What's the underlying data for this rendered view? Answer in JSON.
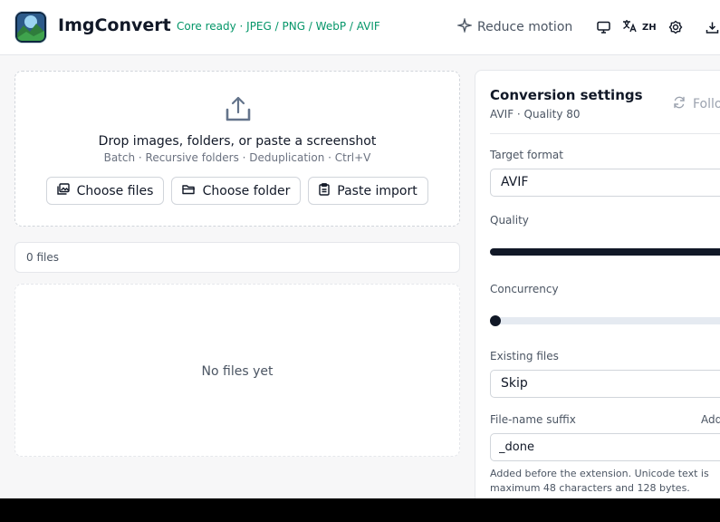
{
  "header": {
    "app_name": "ImgConvert",
    "core_status": "Core ready · JPEG / PNG / WebP / AVIF",
    "reduce_motion_label": "Reduce motion",
    "lang_label": "ZH",
    "icons": [
      "logo-icon",
      "sparkle-icon",
      "monitor-icon",
      "translate-icon",
      "theme-icon",
      "download-icon"
    ]
  },
  "dropzone": {
    "title": "Drop images, folders, or paste a screenshot",
    "subtitle": "Batch · Recursive folders · Deduplication · Ctrl+V",
    "buttons": {
      "choose_files": "Choose files",
      "choose_folder": "Choose folder",
      "paste_import": "Paste import"
    }
  },
  "files": {
    "count_label": "0 files",
    "empty_text": "No files yet"
  },
  "settings": {
    "title": "Conversion settings",
    "subtitle": "AVIF · Quality 80",
    "follow_label": "Follo",
    "target_format_label": "Target format",
    "target_format_value": "AVIF",
    "quality_label": "Quality",
    "quality_fraction": 1.0,
    "concurrency_label": "Concurrency",
    "concurrency_fraction": 0.0,
    "existing_files_label": "Existing files",
    "existing_files_value": "Skip",
    "suffix_label": "File-name suffix",
    "suffix_add_label": "Add",
    "suffix_value": "_done",
    "suffix_hint": "Added before the extension. Unicode text is maximum 48 characters and 128 bytes."
  },
  "colors": {
    "accent_green": "#059669",
    "slider_dark": "#111827",
    "slider_track": "#e5eaf1"
  }
}
